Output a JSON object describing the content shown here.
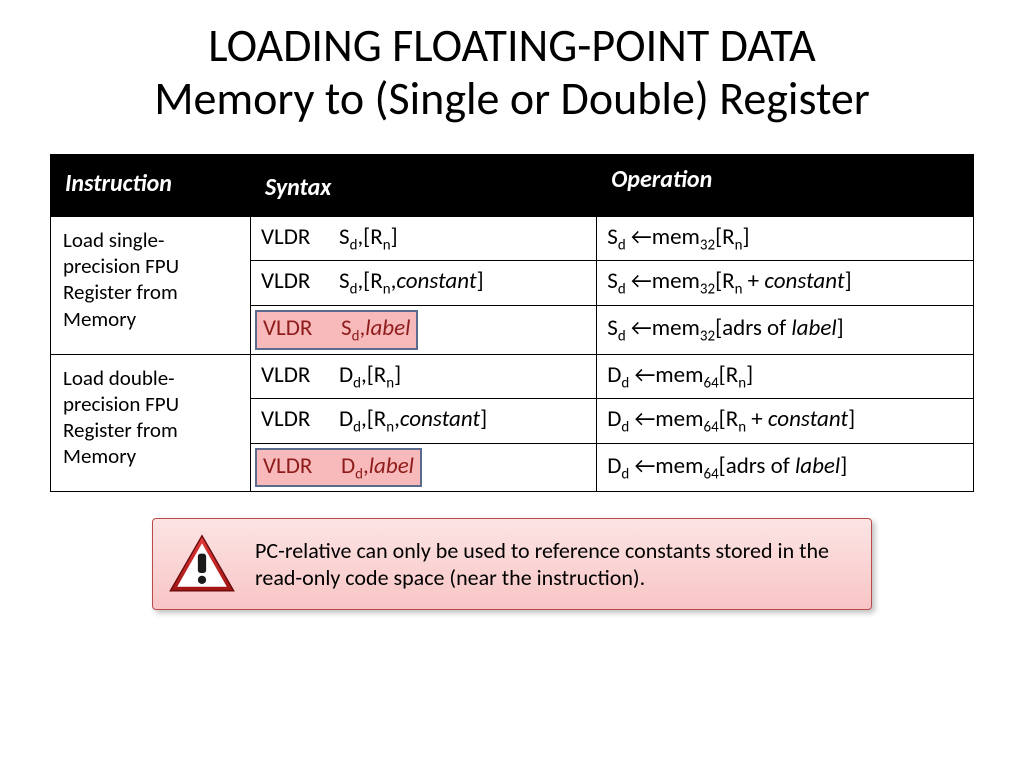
{
  "title_line1": "LOADING FLOATING-POINT DATA",
  "title_line2": "Memory to (Single or Double) Register",
  "headers": {
    "c1": "Instruction",
    "c2": "Syntax",
    "c3": "Operation"
  },
  "groups": [
    {
      "label": "Load single-precision FPU Register from Memory",
      "rows": [
        {
          "syntax_html": "<span class='mnemonic'>VLDR</span>S<sub>d</sub>,[R<sub>n</sub>]",
          "op_html": "S<sub>d</sub> ←mem<sub>32</sub>[R<sub>n</sub>]",
          "highlight": false
        },
        {
          "syntax_html": "<span class='mnemonic'>VLDR</span>S<sub>d</sub>,[R<sub>n</sub>,<span class='ital'>constant</span>]",
          "op_html": "S<sub>d</sub> ←mem<sub>32</sub>[R<sub>n</sub> + <span class='ital'>constant</span>]",
          "highlight": false
        },
        {
          "syntax_html": "<span class='mnemonic'>VLDR</span>S<sub>d</sub>,<span class='ital'>label</span>",
          "op_html": "S<sub>d</sub> ←mem<sub>32</sub>[adrs of <span class='ital'>label</span>]",
          "highlight": true
        }
      ]
    },
    {
      "label": "Load double-precision FPU Register from Memory",
      "rows": [
        {
          "syntax_html": "<span class='mnemonic'>VLDR</span>D<sub>d</sub>,[R<sub>n</sub>]",
          "op_html": "D<sub>d</sub> ←mem<sub>64</sub>[R<sub>n</sub>]",
          "highlight": false
        },
        {
          "syntax_html": "<span class='mnemonic'>VLDR</span>D<sub>d</sub>,[R<sub>n</sub>,<span class='ital'>constant</span>]",
          "op_html": "D<sub>d</sub> ←mem<sub>64</sub>[R<sub>n</sub> + <span class='ital'>constant</span>]",
          "highlight": false
        },
        {
          "syntax_html": "<span class='mnemonic'>VLDR</span>D<sub>d</sub>,<span class='ital'>label</span>",
          "op_html": "D<sub>d</sub> ←mem<sub>64</sub>[adrs of <span class='ital'>label</span>]",
          "highlight": true
        }
      ]
    }
  ],
  "note": "PC-relative can only be used to reference constants stored in the read-only code space (near the instruction)."
}
